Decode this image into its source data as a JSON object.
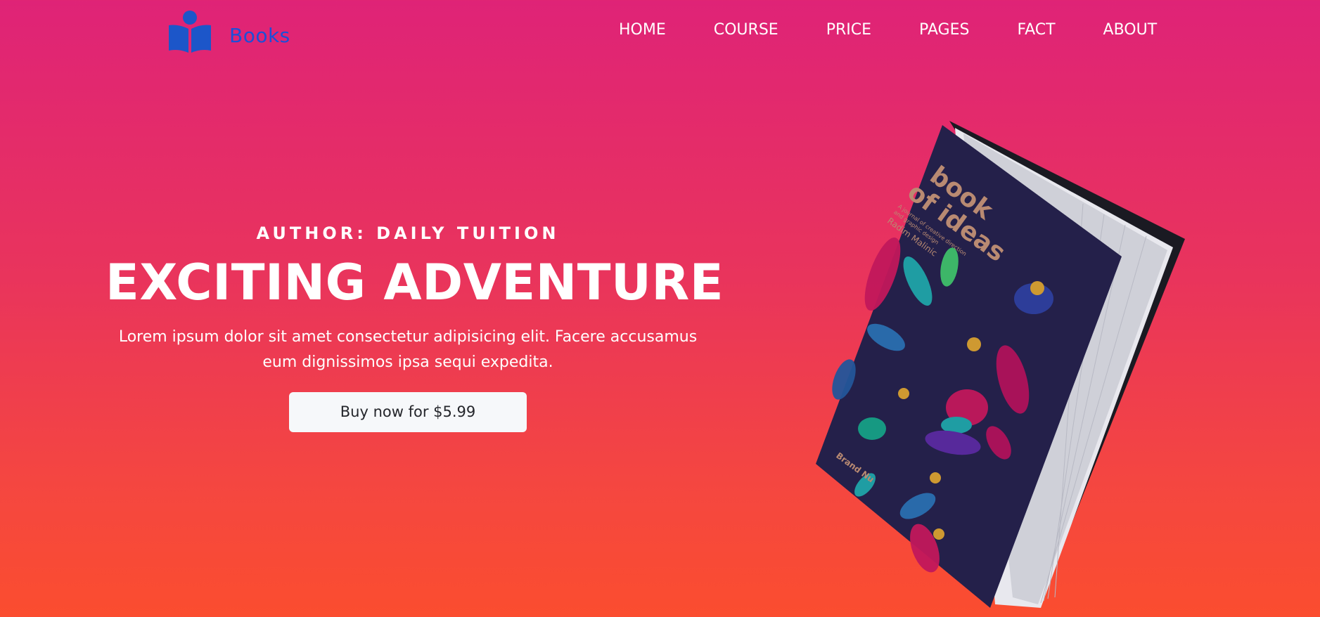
{
  "header": {
    "logo_text": "Books",
    "logo_icon": "reader-book-icon",
    "nav": [
      "HOME",
      "COURSE",
      "PRICE",
      "PAGES",
      "FACT",
      "ABOUT"
    ]
  },
  "hero": {
    "author": "AUTHOR: DAILY TUITION",
    "title": "EXCITING ADVENTURE",
    "description": "Lorem ipsum dolor sit amet consectetur adipisicing elit. Facere accusamus eum dignissimos ipsa sequi expedita.",
    "button_label": "Buy now for $5.99"
  },
  "book": {
    "cover_title_line1": "book",
    "cover_title_line2": "of ideas",
    "cover_subtitle_line1": "A journal of creative direction",
    "cover_subtitle_line2": "and graphic design",
    "cover_author": "Radim Malinic",
    "cover_publisher": "Brand Nu"
  },
  "colors": {
    "gradient_top": "#df2377",
    "gradient_bottom": "#fb4d2f",
    "logo_blue": "#1c4fd8",
    "button_bg": "#f6f8fa",
    "cover_navy": "#24204a"
  }
}
